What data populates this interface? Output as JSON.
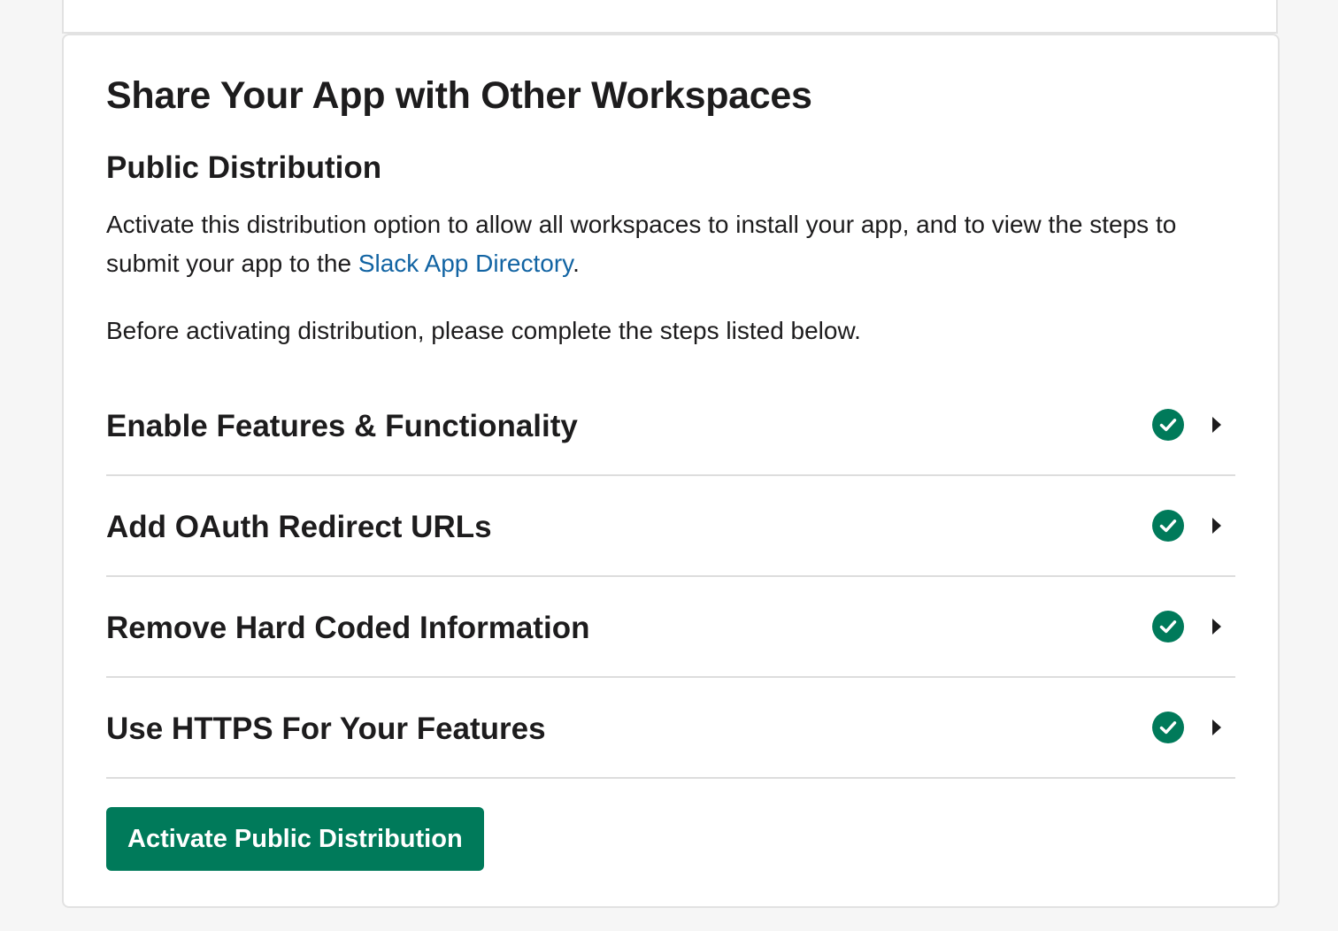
{
  "section": {
    "title": "Share Your App with Other Workspaces",
    "subtitle": "Public Distribution",
    "description_before_link": "Activate this distribution option to allow all workspaces to install your app, and to view the steps to submit your app to the ",
    "description_link": "Slack App Directory",
    "description_after_link": ".",
    "note": "Before activating distribution, please complete the steps listed below."
  },
  "steps": [
    {
      "label": "Enable Features & Functionality",
      "status": "complete"
    },
    {
      "label": "Add OAuth Redirect URLs",
      "status": "complete"
    },
    {
      "label": "Remove Hard Coded Information",
      "status": "complete"
    },
    {
      "label": "Use HTTPS For Your Features",
      "status": "complete"
    }
  ],
  "button": {
    "activate_label": "Activate Public Distribution"
  },
  "colors": {
    "accent_green": "#007a5a",
    "link_blue": "#1264a3",
    "text": "#1d1c1d"
  },
  "icons": {
    "step_status": "check-circle-icon",
    "step_expand": "chevron-right-icon"
  }
}
